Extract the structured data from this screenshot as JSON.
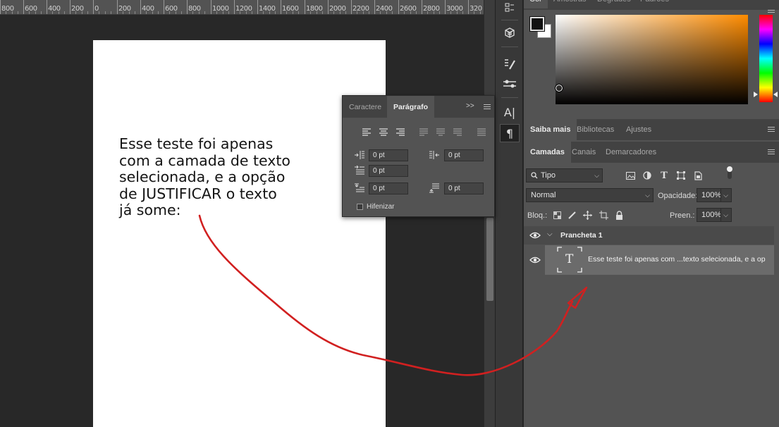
{
  "ruler": {
    "labels": [
      "800",
      "600",
      "400",
      "200",
      "0",
      "200",
      "400",
      "600",
      "800",
      "1000",
      "1200",
      "1400",
      "1600",
      "1800",
      "2000",
      "2200",
      "2400",
      "2600",
      "2800",
      "3000",
      "320"
    ]
  },
  "canvas": {
    "text_lines": [
      "Esse teste foi apenas",
      "com a camada de texto",
      "selecionada, e a opção",
      "de JUSTIFICAR o texto",
      "já some:"
    ],
    "annotation_color": "#d12020"
  },
  "tools": {
    "icons": [
      "brush-settings-icon",
      "3d-cube-icon",
      "brush-presets-icon",
      "adjustments-icon",
      "character-icon",
      "paragraph-icon"
    ],
    "character_glyph": "A|",
    "paragraph_glyph": "¶"
  },
  "color_panel": {
    "tabs": [
      "Cor",
      "Amostras",
      "Degradês",
      "Padrões"
    ],
    "foreground": "#000000",
    "background": "#ffffff",
    "picker_hue": "#ff8c00"
  },
  "learn_panel": {
    "tabs": [
      "Saiba mais",
      "Bibliotecas",
      "Ajustes"
    ]
  },
  "layers_panel": {
    "tabs": [
      "Camadas",
      "Canais",
      "Demarcadores"
    ],
    "filter_label": "Tipo",
    "blend_mode": "Normal",
    "opacity_label": "Opacidade:",
    "opacity_value": "100%",
    "lock_label": "Bloq.:",
    "fill_label": "Preen.:",
    "fill_value": "100%",
    "group_name": "Prancheta 1",
    "layer_name": "Esse teste foi apenas com ...texto selecionada, e a op",
    "layer_thumb_glyph": "T"
  },
  "paragraph_panel": {
    "tabs": [
      "Caractere",
      "Parágrafo"
    ],
    "expand_glyph": ">>",
    "indent_left": "0 pt",
    "indent_right": "0 pt",
    "indent_first": "0 pt",
    "space_before": "0 pt",
    "space_after": "0 pt",
    "hyphenate_label": "Hifenizar"
  }
}
